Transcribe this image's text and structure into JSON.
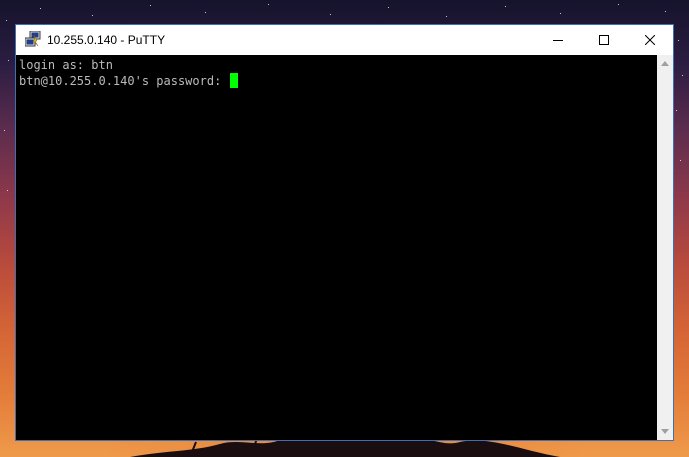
{
  "window": {
    "title": "10.255.0.140 - PuTTY",
    "app_icon": "putty-icon",
    "controls": {
      "minimize_icon": "minimize-icon",
      "maximize_icon": "maximize-icon",
      "close_icon": "close-icon"
    }
  },
  "terminal": {
    "lines": [
      "login as: btn",
      "btn@10.255.0.140's password: "
    ],
    "text_color": "#bbbbbb",
    "background": "#000000",
    "cursor_color": "#00ff00"
  },
  "scrollbar": {
    "up_icon": "scroll-up-arrow-icon",
    "down_icon": "scroll-down-arrow-icon"
  }
}
